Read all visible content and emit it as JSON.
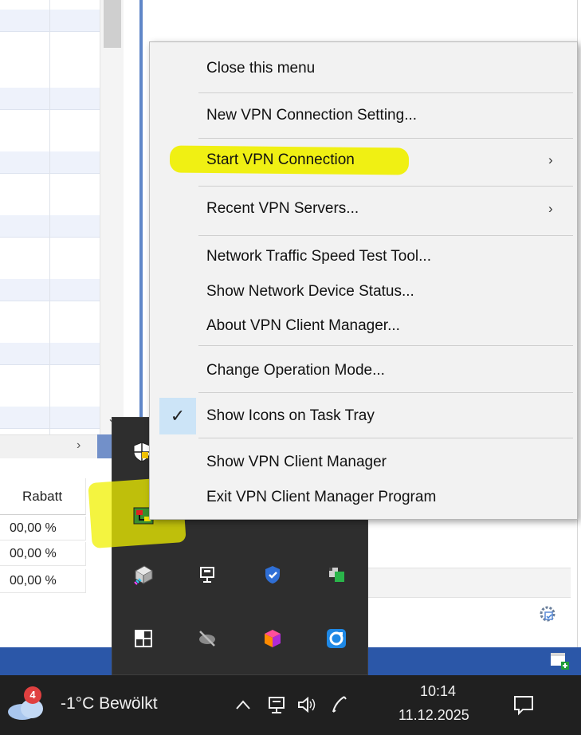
{
  "spreadsheet": {
    "column_header": "Rabatt",
    "rows": [
      "00,00 %",
      "00,00 %",
      "00,00 %"
    ]
  },
  "context_menu": {
    "items": [
      {
        "label": "Close this menu"
      },
      {
        "label": "New VPN Connection Setting..."
      },
      {
        "label": "Start VPN Connection",
        "arrow": "›"
      },
      {
        "label": "Recent VPN Servers...",
        "arrow": "›"
      },
      {
        "label": "Network Traffic Speed Test Tool..."
      },
      {
        "label": "Show Network Device Status..."
      },
      {
        "label": "About VPN Client Manager..."
      },
      {
        "label": "Change Operation Mode..."
      },
      {
        "label": "Show Icons on Task Tray",
        "checked": true
      },
      {
        "label": "Show VPN Client Manager"
      },
      {
        "label": "Exit VPN Client Manager Program"
      }
    ],
    "check_mark": "✓"
  },
  "taskbar": {
    "weather": {
      "badge": "4",
      "text": "-1°C  Bewölkt"
    },
    "overflow_chevron": "^",
    "clock": {
      "time": "10:14",
      "date": "11.12.2025"
    }
  },
  "icons": {
    "tray_flyout": [
      "shield-icon",
      "vpn-client-icon",
      "network-app-icon",
      "defender-icon",
      "monitor-app-icon",
      "windows-app-icon",
      "hidden-network-icon",
      "color-cube-icon",
      "sync-icon"
    ],
    "taskbar": [
      "weather-cloud-icon",
      "chevron-up-icon",
      "network-icon",
      "speaker-icon",
      "pen-icon",
      "notification-icon"
    ]
  },
  "colors": {
    "highlight": "#f0f000",
    "check_background": "#cce4f7",
    "taskbar": "#202020",
    "flyout": "#2e2e2e",
    "status_bar": "#2b57a8"
  }
}
